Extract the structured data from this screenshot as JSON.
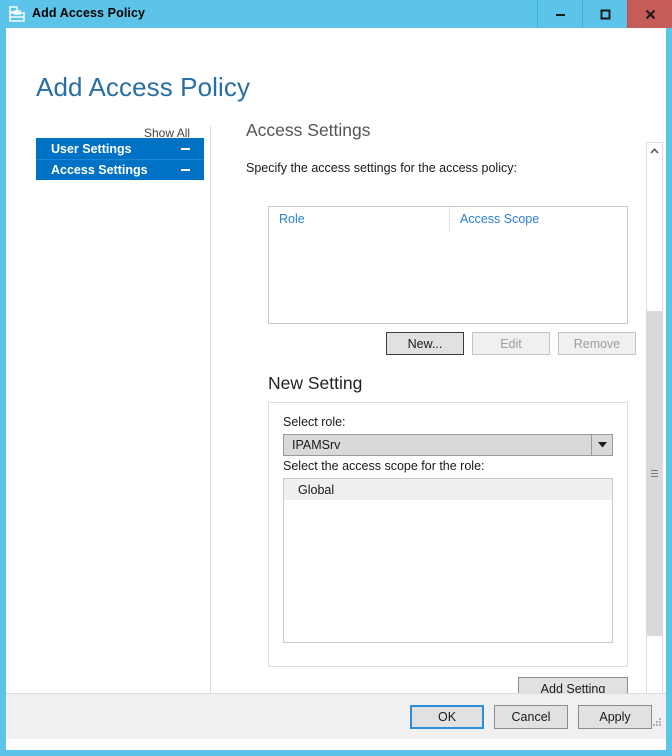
{
  "window": {
    "title": "Add Access Policy",
    "icon": "policy-document-icon",
    "controls": {
      "minimize": "minimize-icon",
      "maximize": "maximize-icon",
      "close": "close-icon"
    },
    "accent_color": "#5bc4e8",
    "close_color": "#c75b57"
  },
  "page": {
    "heading": "Add Access Policy",
    "heading_color": "#2a6ea6"
  },
  "nav": {
    "show_all": "Show All",
    "selected_color": "#0072c6",
    "items": [
      {
        "label": "User Settings",
        "toggle": "collapse-icon"
      },
      {
        "label": "Access Settings",
        "toggle": "collapse-icon"
      }
    ]
  },
  "main": {
    "section_title": "Access Settings",
    "instruction": "Specify the access settings for the access policy:",
    "listview": {
      "columns": [
        "Role",
        "Access Scope"
      ],
      "column_color": "#2a7fd4",
      "rows": []
    },
    "list_buttons": [
      {
        "label": "New...",
        "state": "default"
      },
      {
        "label": "Edit",
        "state": "disabled"
      },
      {
        "label": "Remove",
        "state": "disabled"
      }
    ],
    "new_setting": {
      "title": "New Setting",
      "role_label": "Select role:",
      "role_value": "IPAMSrv",
      "role_arrow": "chevron-down-icon",
      "scope_label": "Select the access scope for the role:",
      "scope_items": [
        "Global"
      ],
      "add_button": "Add Setting"
    }
  },
  "scrollbar": {
    "up": "scroll-up-icon",
    "down": "scroll-down-icon",
    "thumb": "scrollbar-thumb"
  },
  "footer": {
    "buttons": [
      {
        "label": "OK",
        "state": "focus"
      },
      {
        "label": "Cancel",
        "state": "normal"
      },
      {
        "label": "Apply",
        "state": "normal"
      }
    ]
  }
}
